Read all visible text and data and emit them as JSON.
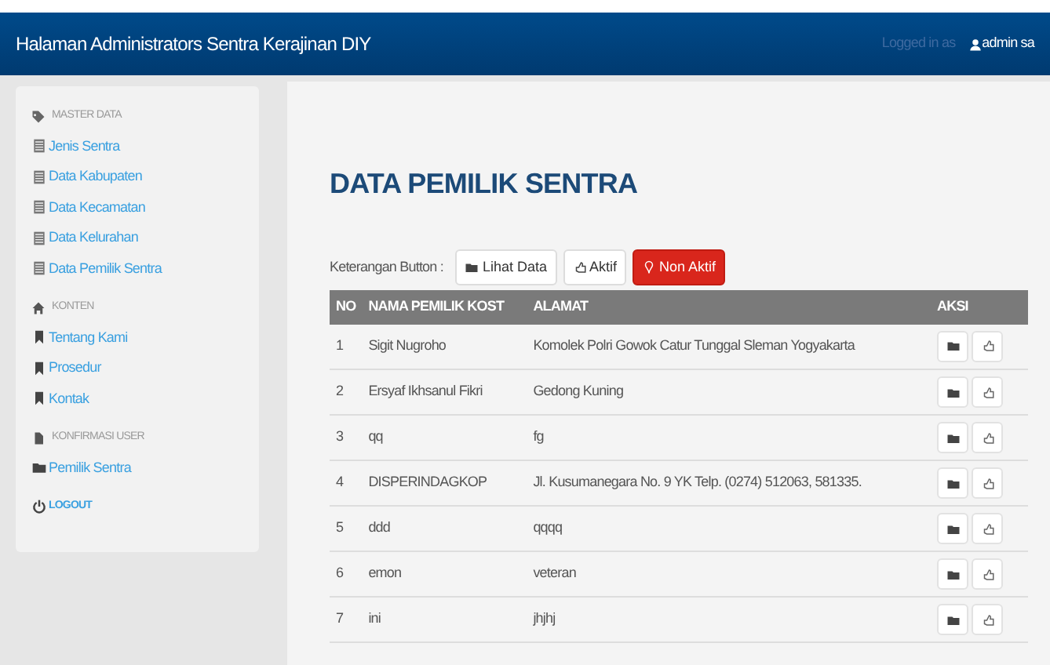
{
  "navbar": {
    "title": "Halaman Administrators Sentra Kerajinan DIY",
    "logged_in_label": "Logged in as",
    "user": "admin sa"
  },
  "sidebar": {
    "sections": [
      {
        "header": "MASTER DATA",
        "items": [
          "Jenis Sentra",
          "Data Kabupaten",
          "Data Kecamatan",
          "Data Kelurahan",
          "Data Pemilik Sentra"
        ]
      },
      {
        "header": "KONTEN",
        "items": [
          "Tentang Kami",
          "Prosedur",
          "Kontak"
        ]
      },
      {
        "header": "KONFIRMASI USER",
        "items": [
          "Pemilik Sentra"
        ]
      }
    ],
    "logout": "LOGOUT"
  },
  "page_title": "DATA PEMILIK SENTRA",
  "legend": {
    "label": "Keterangan Button :",
    "buttons": [
      {
        "label": "Lihat Data",
        "kind": "view"
      },
      {
        "label": "Aktif",
        "kind": "activate"
      },
      {
        "label": "Non Aktif",
        "kind": "deactivate"
      }
    ]
  },
  "table": {
    "columns": [
      "NO",
      "NAMA PEMILIK KOST",
      "ALAMAT",
      "AKSI"
    ],
    "rows": [
      {
        "no": "1",
        "name": "Sigit Nugroho",
        "address": "Komolek Polri Gowok Catur Tunggal Sleman Yogyakarta"
      },
      {
        "no": "2",
        "name": "Ersyaf Ikhsanul Fikri",
        "address": "Gedong Kuning"
      },
      {
        "no": "3",
        "name": "qq",
        "address": "fg"
      },
      {
        "no": "4",
        "name": "DISPERINDAGKOP",
        "address": "Jl. Kusumanegara No. 9 YK Telp. (0274) 512063, 581335."
      },
      {
        "no": "5",
        "name": "ddd",
        "address": "qqqq"
      },
      {
        "no": "6",
        "name": "emon",
        "address": "veteran"
      },
      {
        "no": "7",
        "name": "ini",
        "address": "jhjhj"
      }
    ]
  }
}
